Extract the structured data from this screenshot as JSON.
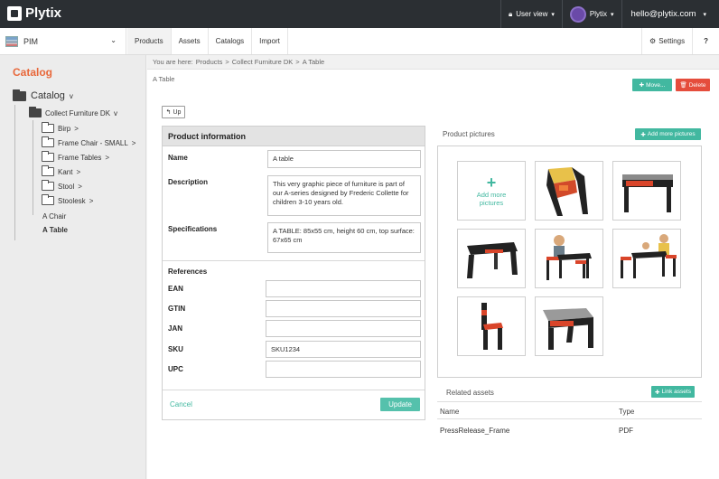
{
  "app": {
    "name": "Plytix",
    "user_view": "User view",
    "account": "Plytix",
    "email": "hello@plytix.com",
    "module": "PIM"
  },
  "nav": {
    "tabs": [
      "Products",
      "Assets",
      "Catalogs",
      "Import"
    ],
    "settings": "Settings",
    "help": "?"
  },
  "sidebar": {
    "title": "Catalog",
    "root": "Catalog",
    "collection": "Collect Furniture DK",
    "folders": [
      "Birp",
      "Frame Chair - SMALL",
      "Frame Tables",
      "Kant",
      "Stool",
      "Stoolesk"
    ],
    "items": [
      "A Chair",
      "A Table"
    ]
  },
  "breadcrumb": {
    "prefix": "You are here:",
    "parts": [
      "Products",
      "Collect Furniture DK",
      "A Table"
    ],
    "sep": ">"
  },
  "page": {
    "subtitle": "A Table",
    "move_label": "Move...",
    "delete_label": "Delete",
    "up_label": "Up"
  },
  "product_info": {
    "title": "Product information",
    "name_label": "Name",
    "name_value": "A table",
    "description_label": "Description",
    "description_value": "This very graphic piece of furniture is part of our A-series designed by Frederic Collette for children 3-10 years old.",
    "specifications_label": "Specifications",
    "specifications_value": "A TABLE: 85x55 cm, height 60 cm, top surface: 67x65 cm",
    "references_label": "References",
    "ean_label": "EAN",
    "ean_value": "",
    "gtin_label": "GTIN",
    "gtin_value": "",
    "jan_label": "JAN",
    "jan_value": "",
    "sku_label": "SKU",
    "sku_value": "SKU1234",
    "upc_label": "UPC",
    "upc_value": "",
    "cancel_label": "Cancel",
    "update_label": "Update"
  },
  "pictures": {
    "title": "Product pictures",
    "add_button": "Add more pictures",
    "add_tile": "Add more pictures"
  },
  "assets": {
    "title": "Related assets",
    "link_button": "Link assets",
    "col_name": "Name",
    "col_type": "Type",
    "rows": [
      {
        "name": "PressRelease_Frame",
        "type": "PDF"
      }
    ]
  },
  "colors": {
    "accent": "#42b8a0",
    "danger": "#e54d3c",
    "catalog_title": "#e8683b",
    "topbar": "#2b2f33"
  }
}
